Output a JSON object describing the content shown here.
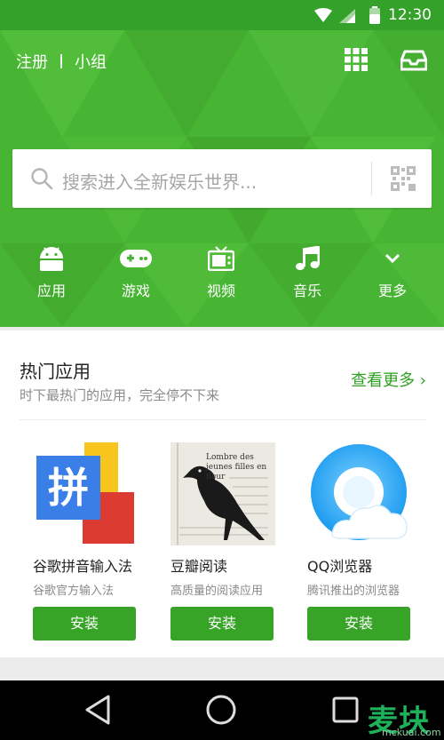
{
  "status": {
    "time": "12:30"
  },
  "header": {
    "register": "注册",
    "group": "小组",
    "search_placeholder": "搜索进入全新娱乐世界..."
  },
  "categories": [
    {
      "label": "应用",
      "icon": "android-icon"
    },
    {
      "label": "游戏",
      "icon": "gamepad-icon"
    },
    {
      "label": "视频",
      "icon": "tv-icon"
    },
    {
      "label": "音乐",
      "icon": "music-note-icon"
    },
    {
      "label": "更多",
      "icon": "chevron-down-icon"
    }
  ],
  "hot_section": {
    "title": "热门应用",
    "subtitle": "时下最热门的应用，完全停不下来",
    "more": "查看更多 ›",
    "apps": [
      {
        "name": "谷歌拼音输入法",
        "desc": "谷歌官方输入法",
        "button": "安装",
        "logo_text": "拼"
      },
      {
        "name": "豆瓣阅读",
        "desc": "高质量的阅读应用",
        "button": "安装",
        "logo_text": "Lombre des jeunes filles en fleur"
      },
      {
        "name": "QQ浏览器",
        "desc": "腾讯推出的浏览器",
        "button": "安装"
      }
    ]
  },
  "watermark": {
    "main": "麦块",
    "sub": "mckuai.com"
  },
  "colors": {
    "brand_green": "#48b433",
    "button_green": "#37a327",
    "link_green": "#2ea022"
  }
}
